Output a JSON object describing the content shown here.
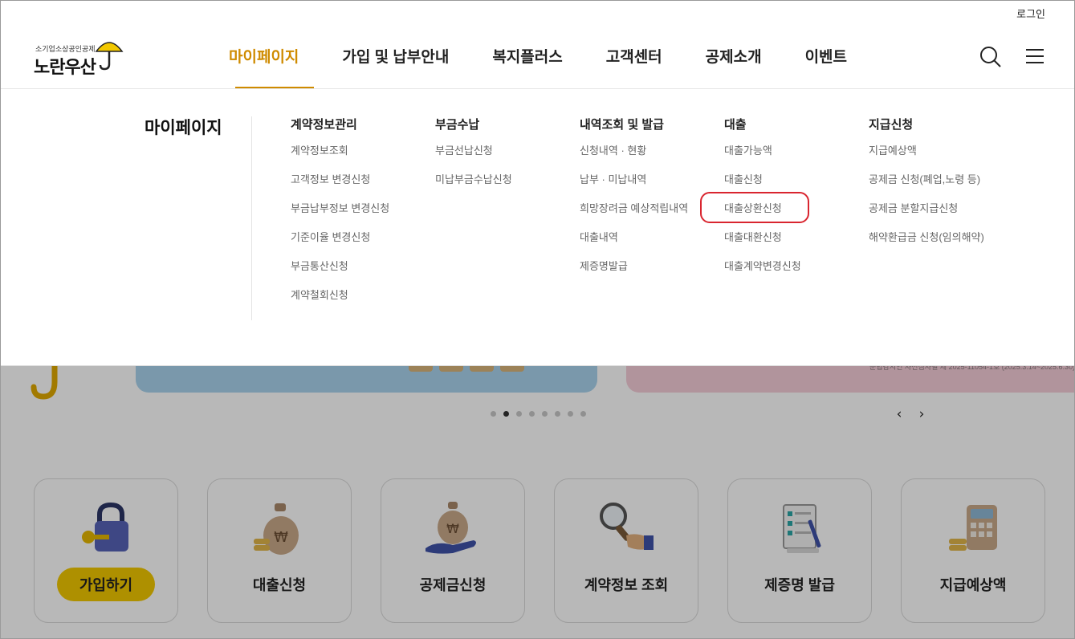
{
  "header": {
    "login": "로그인",
    "logo_sub": "소기업소상공인공제",
    "logo_main": "노란우산",
    "nav": [
      "마이페이지",
      "가입 및 납부안내",
      "복지플러스",
      "고객센터",
      "공제소개",
      "이벤트"
    ],
    "active_nav_index": 0,
    "icons": {
      "search": "search-icon",
      "menu": "hamburger-menu-icon"
    }
  },
  "mega_menu": {
    "title": "마이페이지",
    "columns": [
      {
        "heading": "계약정보관리",
        "items": [
          "계약정보조회",
          "고객정보 변경신청",
          "부금납부정보 변경신청",
          "기준이율 변경신청",
          "부금통산신청",
          "계약철회신청"
        ]
      },
      {
        "heading": "부금수납",
        "items": [
          "부금선납신청",
          "미납부금수납신청"
        ]
      },
      {
        "heading": "내역조회 및 발급",
        "items": [
          "신청내역 · 현황",
          "납부 · 미납내역",
          "희망장려금 예상적립내역",
          "대출내역",
          "제증명발급"
        ]
      },
      {
        "heading": "대출",
        "items": [
          "대출가능액",
          "대출신청",
          "대출상환신청",
          "대출대환신청",
          "대출계약변경신청"
        ]
      },
      {
        "heading": "지급신청",
        "items": [
          "지급예상액",
          "공제금 신청(폐업,노령 등)",
          "공제금 분할지급신청",
          "해약환급금 신청(임의해약)"
        ]
      }
    ],
    "highlighted_item": "대출상환신청"
  },
  "banner": {
    "fine_print": "준법감시인 사전심사필 제 2025-11054-1호 (2025.3.14~2025.6.30)",
    "slide_count": 8,
    "active_slide": 1
  },
  "quick_menu": [
    {
      "label": "가입하기",
      "icon": "padlock-key-icon",
      "style": "button"
    },
    {
      "label": "대출신청",
      "icon": "money-bag-icon"
    },
    {
      "label": "공제금신청",
      "icon": "money-bag-hand-icon"
    },
    {
      "label": "계약정보 조회",
      "icon": "magnifier-icon"
    },
    {
      "label": "제증명 발급",
      "icon": "checklist-document-icon"
    },
    {
      "label": "지급예상액",
      "icon": "calculator-icon"
    }
  ],
  "colors": {
    "accent": "#cf8b00",
    "highlight_ring": "#d9252f",
    "join_button": "#f2c800"
  }
}
